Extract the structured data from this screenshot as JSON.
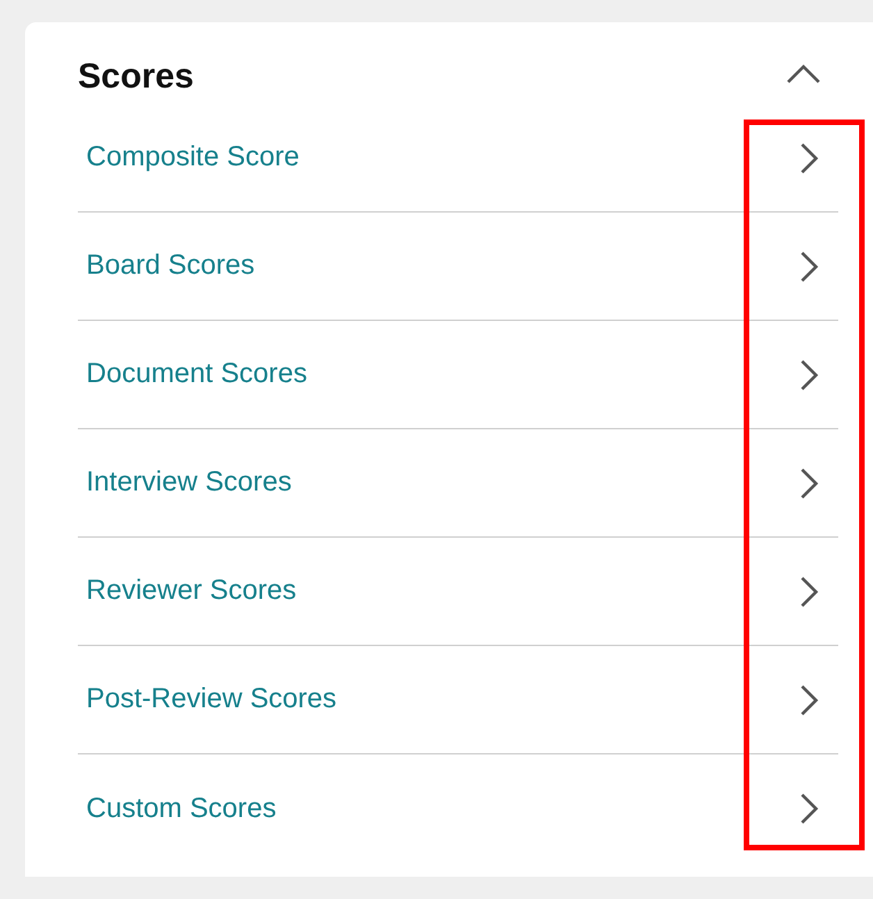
{
  "panel": {
    "title": "Scores",
    "expanded": true
  },
  "items": [
    {
      "label": "Composite Score"
    },
    {
      "label": "Board Scores"
    },
    {
      "label": "Document Scores"
    },
    {
      "label": "Interview Scores"
    },
    {
      "label": "Reviewer Scores"
    },
    {
      "label": "Post-Review Scores"
    },
    {
      "label": "Custom Scores"
    }
  ]
}
